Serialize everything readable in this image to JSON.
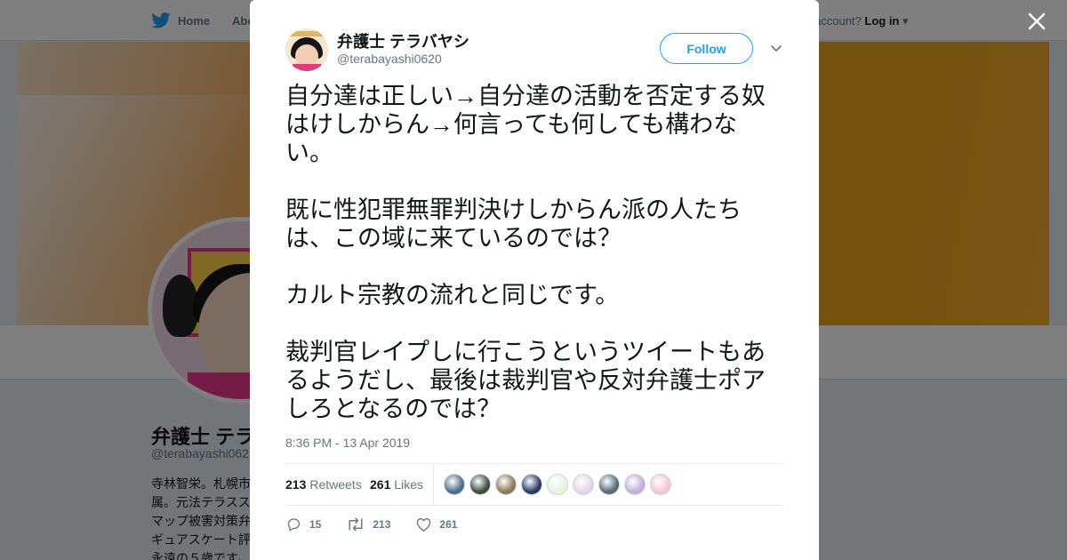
{
  "background": {
    "nav": {
      "home_label": "Home",
      "about_label": "Abo",
      "account_prefix": "account?",
      "login_label": "Log in"
    },
    "profile": {
      "name": "弁護士 テラ",
      "handle": "@terabayashi062",
      "bio": [
        "寺林智栄。札幌市",
        "属。元法テラスス",
        "マップ被害対策弁",
        "ギュアスケート評",
        "永遠の５歳です。"
      ]
    }
  },
  "tweet": {
    "author_name": "弁護士 テラバヤシ",
    "author_handle": "@terabayashi0620",
    "follow_label": "Follow",
    "paragraphs": [
      "自分達は正しい→自分達の活動を否定する奴はけしからん→何言っても何しても構わない。",
      "既に性犯罪無罪判決けしからん派の人たちは、この域に来ているのでは？",
      "カルト宗教の流れと同じです。",
      "裁判官レイプしに行こうというツイートもあるようだし、最後は裁判官や反対弁護士ポアしろとなるのでは？"
    ],
    "timestamp": "8:36 PM - 13 Apr 2019",
    "stats": {
      "retweets_count": "213",
      "retweets_label": "Retweets",
      "likes_count": "261",
      "likes_label": "Likes"
    },
    "liker_avatar_colors": [
      "#4a6f8a",
      "#3c4f3a",
      "#8a7a55",
      "#2a3a6a",
      "#e8f0e0",
      "#e4d4e8",
      "#5a6a78",
      "#c0b0d8",
      "#f3c6d6"
    ],
    "actions": {
      "reply_count": "15",
      "retweet_count": "213",
      "like_count": "261"
    }
  },
  "colors": {
    "accent": "#1da1f2",
    "text": "#14171a",
    "muted": "#657786"
  }
}
